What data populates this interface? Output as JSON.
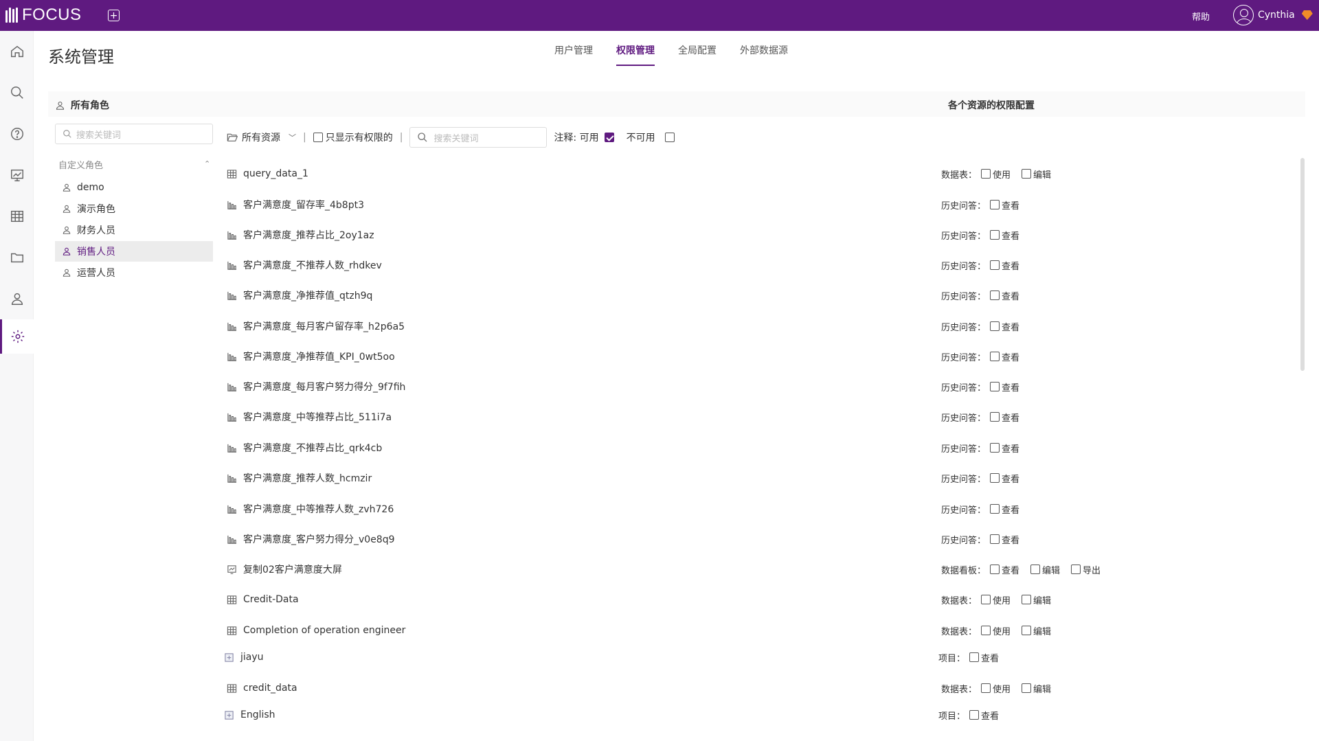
{
  "app": {
    "logo_text": "FOCUS",
    "help": "帮助",
    "user_name": "Cynthia",
    "accent": "#5f1a80"
  },
  "nav": [
    "home-icon",
    "search-icon",
    "help-icon",
    "dashboard-icon",
    "table-icon",
    "folder-icon",
    "user-icon",
    "settings-icon"
  ],
  "page": {
    "title": "系统管理"
  },
  "tabs": [
    {
      "label": "用户管理",
      "active": false
    },
    {
      "label": "权限管理",
      "active": true
    },
    {
      "label": "全局配置",
      "active": false
    },
    {
      "label": "外部数据源",
      "active": false
    }
  ],
  "roles": {
    "title": "所有角色",
    "search_placeholder": "搜索关键词",
    "group_label": "自定义角色",
    "items": [
      {
        "label": "demo",
        "selected": false
      },
      {
        "label": "演示角色",
        "selected": false
      },
      {
        "label": "财务人员",
        "selected": false
      },
      {
        "label": "销售人员",
        "selected": true
      },
      {
        "label": "运营人员",
        "selected": false
      }
    ]
  },
  "permissions": {
    "title": "各个资源的权限配置",
    "filter_label": "所有资源",
    "only_granted_label": "只显示有权限的",
    "search_placeholder": "搜索关键词",
    "legend_prefix": "注释: 可用",
    "legend_unavailable": "不可用"
  },
  "resources": [
    {
      "icon": "table-icon",
      "name": "query_data_1",
      "perm_label": "数据表：",
      "options": [
        "使用",
        "编辑"
      ]
    },
    {
      "icon": "chart-icon",
      "name": "客户满意度_留存率_4b8pt3",
      "perm_label": "历史问答：",
      "options": [
        "查看"
      ]
    },
    {
      "icon": "chart-icon",
      "name": "客户满意度_推荐占比_2oy1az",
      "perm_label": "历史问答：",
      "options": [
        "查看"
      ]
    },
    {
      "icon": "chart-icon",
      "name": "客户满意度_不推荐人数_rhdkev",
      "perm_label": "历史问答：",
      "options": [
        "查看"
      ]
    },
    {
      "icon": "chart-icon",
      "name": "客户满意度_净推荐值_qtzh9q",
      "perm_label": "历史问答：",
      "options": [
        "查看"
      ]
    },
    {
      "icon": "chart-icon",
      "name": "客户满意度_每月客户留存率_h2p6a5",
      "perm_label": "历史问答：",
      "options": [
        "查看"
      ]
    },
    {
      "icon": "chart-icon",
      "name": "客户满意度_净推荐值_KPI_0wt5oo",
      "perm_label": "历史问答：",
      "options": [
        "查看"
      ]
    },
    {
      "icon": "chart-icon",
      "name": "客户满意度_每月客户努力得分_9f7fih",
      "perm_label": "历史问答：",
      "options": [
        "查看"
      ]
    },
    {
      "icon": "chart-icon",
      "name": "客户满意度_中等推荐占比_511i7a",
      "perm_label": "历史问答：",
      "options": [
        "查看"
      ]
    },
    {
      "icon": "chart-icon",
      "name": "客户满意度_不推荐占比_qrk4cb",
      "perm_label": "历史问答：",
      "options": [
        "查看"
      ]
    },
    {
      "icon": "chart-icon",
      "name": "客户满意度_推荐人数_hcmzir",
      "perm_label": "历史问答：",
      "options": [
        "查看"
      ]
    },
    {
      "icon": "chart-icon",
      "name": "客户满意度_中等推荐人数_zvh726",
      "perm_label": "历史问答：",
      "options": [
        "查看"
      ]
    },
    {
      "icon": "chart-icon",
      "name": "客户满意度_客户努力得分_v0e8q9",
      "perm_label": "历史问答：",
      "options": [
        "查看"
      ]
    },
    {
      "icon": "dashboard-icon",
      "name": "复制02客户满意度大屏",
      "perm_label": "数据看板：",
      "options": [
        "查看",
        "编辑",
        "导出"
      ]
    },
    {
      "icon": "table-icon",
      "name": "Credit-Data",
      "perm_label": "数据表：",
      "options": [
        "使用",
        "编辑"
      ]
    },
    {
      "icon": "table-icon",
      "name": "Completion of operation engineer",
      "perm_label": "数据表：",
      "options": [
        "使用",
        "编辑"
      ]
    },
    {
      "icon": "expand-icon",
      "name": "jiayu",
      "perm_label": "项目：",
      "options": [
        "查看"
      ]
    },
    {
      "icon": "table-icon",
      "name": "credit_data",
      "perm_label": "数据表：",
      "options": [
        "使用",
        "编辑"
      ]
    },
    {
      "icon": "expand-icon",
      "name": "English",
      "perm_label": "项目：",
      "options": [
        "查看"
      ]
    }
  ]
}
